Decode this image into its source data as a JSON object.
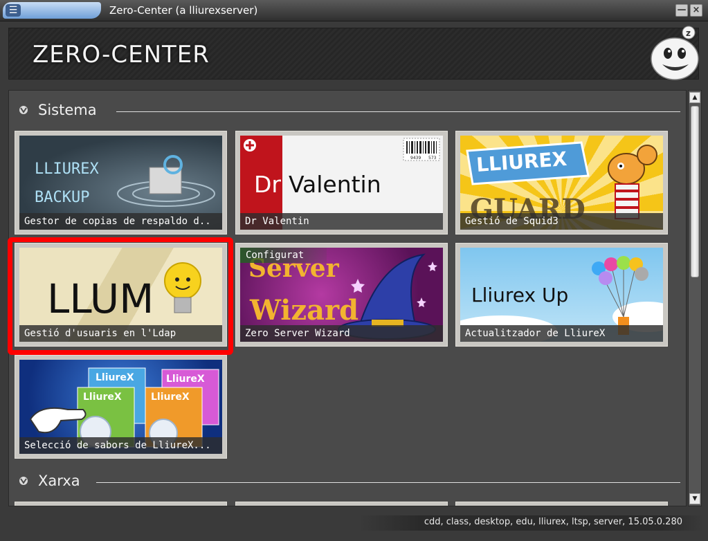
{
  "window": {
    "title": "Zero-Center (a lliurexserver)",
    "menu_glyph": "☰",
    "minimize_glyph": "—",
    "close_glyph": "×"
  },
  "header": {
    "title": "ZERO-CENTER"
  },
  "sections": [
    {
      "label": "Sistema"
    },
    {
      "label": "Xarxa"
    }
  ],
  "tiles": [
    {
      "caption": "Gestor de copias de respaldo d..",
      "art_line1": "LLIUREX",
      "art_line2": "BACKUP"
    },
    {
      "caption": "Dr Valentin",
      "art_prefix": "Dr",
      "art_name": "Valentin",
      "barcode_left": "9439",
      "barcode_right": "573"
    },
    {
      "caption": "Gestió de Squid3",
      "art_top": "LLIUREX",
      "art_bottom": "GUARD"
    },
    {
      "caption": "Gestió d'usuaris en l'Ldap",
      "art_text": "LLUM"
    },
    {
      "caption": "Zero Server Wizard",
      "status": "Configurat",
      "art_line1": "Server",
      "art_line2": "Wizard"
    },
    {
      "caption": "Actualitzador de LliureX",
      "art_text": "Lliurex Up"
    },
    {
      "caption": "Selecció de sabors de LliureX...",
      "box1": "LliureX",
      "box2": "LliureX",
      "box3": "LliureX",
      "box4": "LliureX"
    }
  ],
  "statusbar": {
    "text": "cdd, class, desktop, edu, lliurex, ltsp, server, 15.05.0.280"
  },
  "scrollbar": {
    "up": "▲",
    "down": "▼"
  },
  "colors": {
    "highlight": "#ff0000",
    "background": "#3a3a3a",
    "content": "#4a4a4a"
  }
}
